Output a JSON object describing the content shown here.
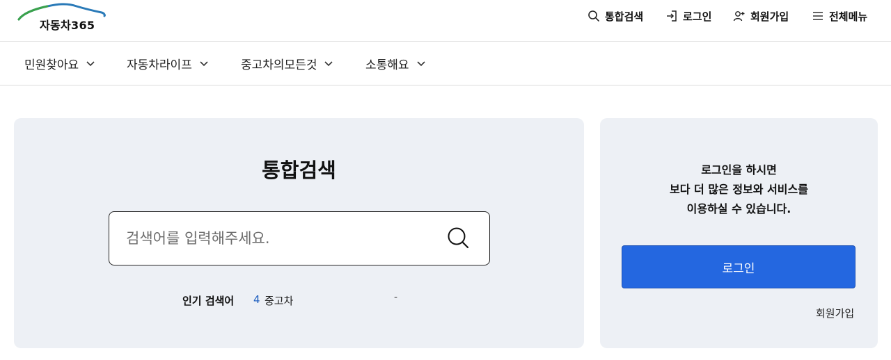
{
  "header": {
    "logo_text": "자동차365",
    "utility": [
      {
        "label": "통합검색",
        "icon": "search-icon"
      },
      {
        "label": "로그인",
        "icon": "login-icon"
      },
      {
        "label": "회원가입",
        "icon": "user-add-icon"
      },
      {
        "label": "전체메뉴",
        "icon": "menu-icon"
      }
    ]
  },
  "gnb": {
    "items": [
      {
        "label": "민원찾아요",
        "icon": "chevron-down-icon"
      },
      {
        "label": "자동차라이프",
        "icon": "chevron-down-icon"
      },
      {
        "label": "중고차의모든것",
        "icon": "chevron-down-icon"
      },
      {
        "label": "소통해요",
        "icon": "chevron-down-icon"
      }
    ]
  },
  "search": {
    "title": "통합검색",
    "placeholder": "검색어를 입력해주세요.",
    "value": "",
    "button_icon": "search-icon",
    "popular": {
      "label": "인기 검색어",
      "rank": "4",
      "keyword": "중고차",
      "change": "-"
    }
  },
  "login_panel": {
    "message_lines": [
      "로그인을 하시면",
      "보다 더 많은 정보와 서비스를",
      "이용하실 수 있습니다."
    ],
    "login_button": "로그인",
    "join_link": "회원가입"
  },
  "colors": {
    "primary": "#2467e0",
    "panel_bg": "#edf0f5",
    "rank_blue": "#1f5fbf",
    "logo_green": "#3aa24a",
    "logo_blue": "#2a7ab8"
  }
}
